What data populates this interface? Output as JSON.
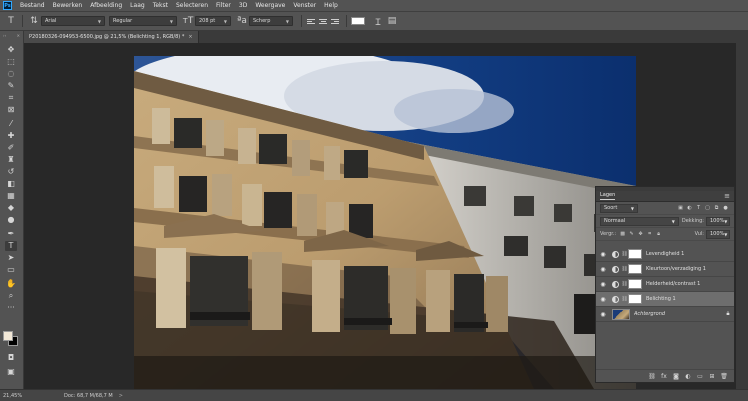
{
  "menubar": {
    "logo": "Ps",
    "items": [
      "Bestand",
      "Bewerken",
      "Afbeelding",
      "Laag",
      "Tekst",
      "Selecteren",
      "Filter",
      "3D",
      "Weergave",
      "Venster",
      "Help"
    ]
  },
  "options": {
    "font_family": "Arial",
    "font_style": "Regular",
    "font_size": "208 pt",
    "antialias": "Scherp",
    "text_color": "#ffffff"
  },
  "tab": {
    "title": "P20180326-094953-6500.jpg @ 21,5% (Belichting 1, RGB/8) *",
    "close": "×"
  },
  "status": {
    "zoom": "21,45%",
    "doc": "Doc: 68,7 M/68,7 M",
    "arrow": ">"
  },
  "layers_panel": {
    "title": "Lagen",
    "filter_label": "Soort",
    "blend_mode": "Normaal",
    "opacity_label": "Dekking:",
    "opacity_value": "100%",
    "lock_label": "Vergr.:",
    "fill_label": "Vul:",
    "fill_value": "100%",
    "layers": [
      {
        "name": "Levendigheid 1",
        "type": "adjustment",
        "selected": false
      },
      {
        "name": "Kleurtoon/verzadiging 1",
        "type": "adjustment",
        "selected": false
      },
      {
        "name": "Helderheid/contrast 1",
        "type": "adjustment",
        "selected": false
      },
      {
        "name": "Belichting 1",
        "type": "adjustment",
        "selected": true
      },
      {
        "name": "Achtergrond",
        "type": "image",
        "selected": false
      }
    ]
  },
  "colors": {
    "foreground": "#f1e7d6",
    "background": "#000000",
    "accent": "#31a8ff"
  }
}
